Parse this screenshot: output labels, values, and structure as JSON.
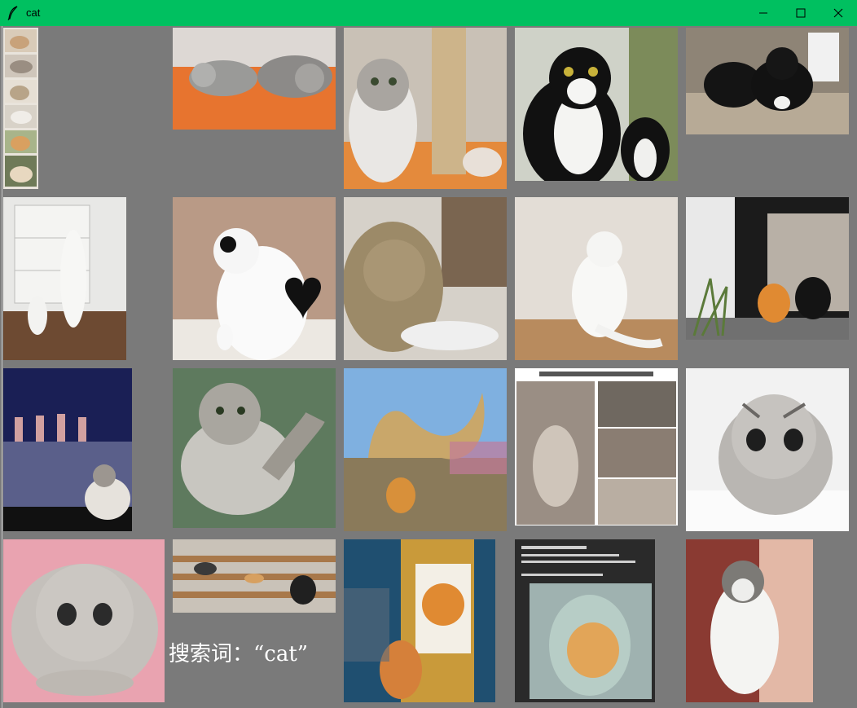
{
  "window": {
    "title": "cat",
    "icon": "feather-icon",
    "controls": [
      "minimize-icon",
      "maximize-icon",
      "close-icon"
    ],
    "titlebar_color": "#00c060",
    "background_color": "#7a7a7a"
  },
  "caption": "搜索词：“cat”",
  "tiles": [
    {
      "name": "cat-photo-strip-thumbnails",
      "desc_icon": "image-icon"
    },
    {
      "name": "cat-photo-two-gray-cats-sleeping"
    },
    {
      "name": "cat-photo-kitten-scratching-post"
    },
    {
      "name": "cat-photo-black-white-cats"
    },
    {
      "name": "cat-photo-two-black-cats-on-floor"
    },
    {
      "name": "cat-photo-cats-on-drawers"
    },
    {
      "name": "cat-photo-heart-pattern-cat"
    },
    {
      "name": "cat-photo-cat-reaching-paw"
    },
    {
      "name": "cat-photo-white-cat-waving"
    },
    {
      "name": "cat-photo-ginger-and-black-cat"
    },
    {
      "name": "cat-photo-cat-watching-dancers"
    },
    {
      "name": "cat-photo-gray-cat-leg-up"
    },
    {
      "name": "cat-photo-shiba-and-straw-dragon"
    },
    {
      "name": "cat-photo-comic-collage"
    },
    {
      "name": "cat-photo-sad-tabby-cat"
    },
    {
      "name": "cat-photo-sad-cat-pink-blanket"
    },
    {
      "name": "cat-photo-classroom-cat"
    },
    {
      "name": "cat-photo-cat-painting-tiger"
    },
    {
      "name": "cat-photo-cat-in-jar-screenshot"
    },
    {
      "name": "cat-photo-held-fluffy-cat"
    }
  ]
}
